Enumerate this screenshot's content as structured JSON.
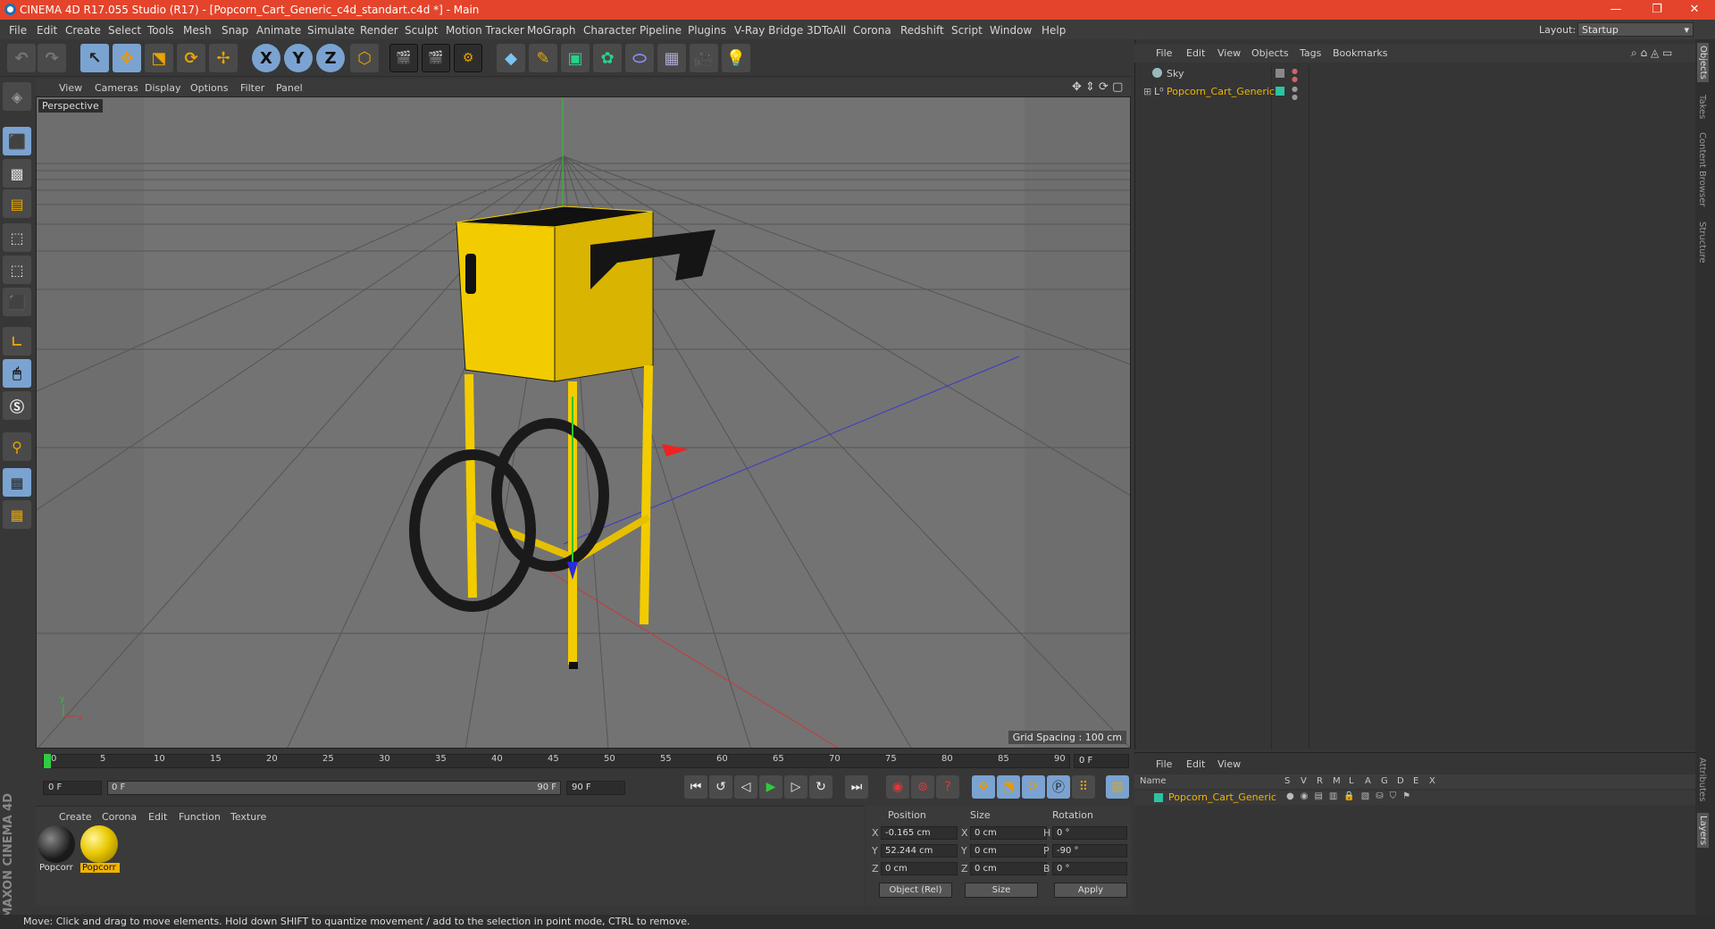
{
  "title": "CINEMA 4D R17.055 Studio (R17) - [Popcorn_Cart_Generic_c4d_standart.c4d *] - Main",
  "window_controls": {
    "min": "—",
    "max": "❐",
    "close": "✕"
  },
  "menus": [
    "File",
    "Edit",
    "Create",
    "Select",
    "Tools",
    "Mesh",
    "Snap",
    "Animate",
    "Simulate",
    "Render",
    "Sculpt",
    "Motion Tracker",
    "MoGraph",
    "Character",
    "Pipeline",
    "Plugins",
    "V-Ray Bridge",
    "3DToAll",
    "Corona",
    "Redshift",
    "Script",
    "Window",
    "Help"
  ],
  "layout": {
    "label": "Layout:",
    "value": "Startup"
  },
  "toolbar": {
    "x_label": "X",
    "y_label": "Y",
    "z_label": "Z"
  },
  "viewport": {
    "menus": [
      "View",
      "Cameras",
      "Display",
      "Options",
      "Filter",
      "Panel"
    ],
    "view_name": "Perspective",
    "grid_spacing": "Grid Spacing : 100 cm"
  },
  "timeline": {
    "ticks": [
      "0",
      "5",
      "10",
      "15",
      "20",
      "25",
      "30",
      "35",
      "40",
      "45",
      "50",
      "55",
      "60",
      "65",
      "70",
      "75",
      "80",
      "85",
      "90"
    ],
    "end_frame": "0 F"
  },
  "transport": {
    "start": "0 F",
    "slider_start": "0 F",
    "slider_end": "90 F",
    "end": "90 F"
  },
  "material_manager": {
    "menus": [
      "Create",
      "Corona",
      "Edit",
      "Function",
      "Texture"
    ],
    "materials": [
      {
        "name": "Popcorr",
        "color": "#2a2a2a",
        "selected": false
      },
      {
        "name": "Popcorr",
        "color": "#e8c800",
        "selected": true
      }
    ]
  },
  "coordinates": {
    "headers": [
      "Position",
      "Size",
      "Rotation"
    ],
    "rows": [
      {
        "axis": "X",
        "pos": "-0.165 cm",
        "size_axis": "X",
        "size": "0 cm",
        "rot_axis": "H",
        "rot": "0 °"
      },
      {
        "axis": "Y",
        "pos": "52.244 cm",
        "size_axis": "Y",
        "size": "0 cm",
        "rot_axis": "P",
        "rot": "-90 °"
      },
      {
        "axis": "Z",
        "pos": "0 cm",
        "size_axis": "Z",
        "size": "0 cm",
        "rot_axis": "B",
        "rot": "0 °"
      }
    ],
    "mode": "Object (Rel)",
    "size_mode": "Size",
    "apply": "Apply"
  },
  "object_manager": {
    "menus": [
      "File",
      "Edit",
      "View",
      "Objects",
      "Tags",
      "Bookmarks"
    ],
    "objects": [
      {
        "name": "Sky",
        "color": "#c8c8c8"
      },
      {
        "name": "Popcorn_Cart_Generic",
        "color": "#f0b400"
      }
    ]
  },
  "layer_manager": {
    "menus": [
      "File",
      "Edit",
      "View"
    ],
    "columns": [
      "Name",
      "S",
      "V",
      "R",
      "M",
      "L",
      "A",
      "G",
      "D",
      "E",
      "X"
    ],
    "layer": "Popcorn_Cart_Generic"
  },
  "right_tabs": [
    "Objects",
    "Takes",
    "Content Browser",
    "Structure",
    "Attributes",
    "Layers"
  ],
  "branding": "MAXON CINEMA 4D",
  "status": "Move: Click and drag to move elements. Hold down SHIFT to quantize movement / add to the selection in point mode, CTRL to remove.",
  "colors": {
    "title_bar": "#e4442b",
    "accent": "#7aa3d1",
    "cart_yellow": "#f2cc00",
    "selection": "#f0b400"
  }
}
